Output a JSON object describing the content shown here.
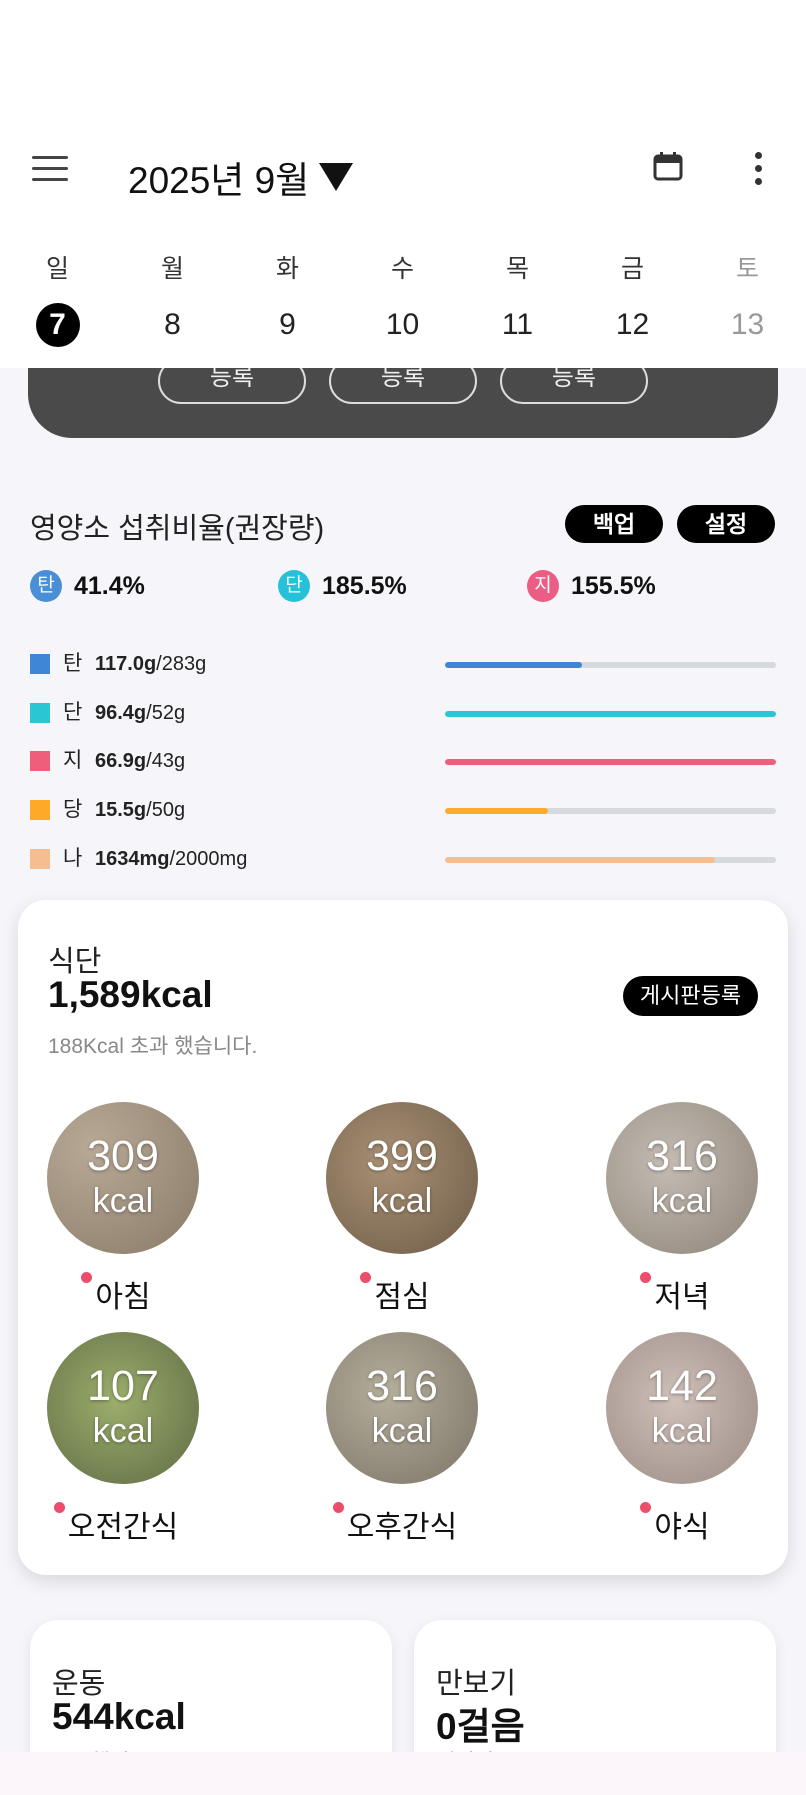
{
  "header": {
    "month_title": "2025년 9월"
  },
  "week": {
    "days": [
      {
        "name": "일",
        "num": "7",
        "selected": true,
        "muted": false
      },
      {
        "name": "월",
        "num": "8",
        "selected": false,
        "muted": false
      },
      {
        "name": "화",
        "num": "9",
        "selected": false,
        "muted": false
      },
      {
        "name": "수",
        "num": "10",
        "selected": false,
        "muted": false
      },
      {
        "name": "목",
        "num": "11",
        "selected": false,
        "muted": false
      },
      {
        "name": "금",
        "num": "12",
        "selected": false,
        "muted": false
      },
      {
        "name": "토",
        "num": "13",
        "selected": false,
        "muted": true
      }
    ]
  },
  "register_buttons": [
    "등록",
    "등록",
    "등록"
  ],
  "nutrition": {
    "title": "영양소 섭취비율(권장량)",
    "backup_label": "백업",
    "settings_label": "설정",
    "ratios": [
      {
        "badge": "탄",
        "pct": "41.4%",
        "color": "#4a8fd6"
      },
      {
        "badge": "단",
        "pct": "185.5%",
        "color": "#26c0d8"
      },
      {
        "badge": "지",
        "pct": "155.5%",
        "color": "#ec5d84"
      }
    ],
    "rows": [
      {
        "label": "탄",
        "amount": "117.0g",
        "target": "/283g",
        "color": "#3f86d6",
        "fraction": 0.413
      },
      {
        "label": "단",
        "amount": "96.4g",
        "target": "/52g",
        "color": "#2ac6d4",
        "fraction": 1.0
      },
      {
        "label": "지",
        "amount": "66.9g",
        "target": "/43g",
        "color": "#ef5f7b",
        "fraction": 1.0
      },
      {
        "label": "당",
        "amount": "15.5g",
        "target": "/50g",
        "color": "#ffa928",
        "fraction": 0.31
      },
      {
        "label": "나",
        "amount": "1634mg",
        "target": "/2000mg",
        "color": "#f5be90",
        "fraction": 0.817
      }
    ]
  },
  "diet": {
    "label": "식단",
    "kcal": "1,589kcal",
    "note": "188Kcal 초과 했습니다.",
    "board_label": "게시판등록",
    "meals": [
      {
        "kcal": "309",
        "unit": "kcal",
        "name": "아침",
        "bg": "#9c8f80"
      },
      {
        "kcal": "399",
        "unit": "kcal",
        "name": "점심",
        "bg": "#8a7a66"
      },
      {
        "kcal": "316",
        "unit": "kcal",
        "name": "저녁",
        "bg": "#a9a098"
      },
      {
        "kcal": "107",
        "unit": "kcal",
        "name": "오전간식",
        "bg": "#7e8e5a"
      },
      {
        "kcal": "316",
        "unit": "kcal",
        "name": "오후간식",
        "bg": "#9a9484"
      },
      {
        "kcal": "142",
        "unit": "kcal",
        "name": "야식",
        "bg": "#b8a8a2"
      }
    ]
  },
  "exercise": {
    "label": "운동",
    "value": "544kcal",
    "sub": "소모했어요"
  },
  "steps": {
    "label": "만보기",
    "value": "0걸음",
    "sub": "걸었어요"
  }
}
